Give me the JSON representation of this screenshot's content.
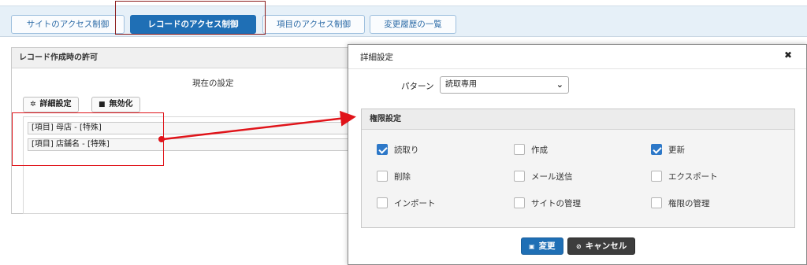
{
  "tabs": [
    {
      "label": "サイトのアクセス制御"
    },
    {
      "label": "レコードのアクセス制御"
    },
    {
      "label": "項目のアクセス制御"
    },
    {
      "label": "変更履歴の一覧"
    }
  ],
  "record_panel": {
    "header": "レコード作成時の許可",
    "current_settings_label": "現在の設定",
    "advanced_button": "詳細設定",
    "disable_button": "無効化",
    "permission_items": [
      "[項目] 母店 - [特殊]",
      "[項目] 店舗名 - [特殊]"
    ]
  },
  "dialog": {
    "title": "詳細設定",
    "close_glyph": "✖",
    "pattern_label": "パターン",
    "pattern_value": "読取専用",
    "permissions_header": "権限設定",
    "permissions": [
      {
        "label": "読取り",
        "checked": true
      },
      {
        "label": "作成",
        "checked": false
      },
      {
        "label": "更新",
        "checked": true
      },
      {
        "label": "削除",
        "checked": false
      },
      {
        "label": "メール送信",
        "checked": false
      },
      {
        "label": "エクスポート",
        "checked": false
      },
      {
        "label": "インポート",
        "checked": false
      },
      {
        "label": "サイトの管理",
        "checked": false
      },
      {
        "label": "権限の管理",
        "checked": false
      }
    ],
    "ok_button": "変更",
    "cancel_button": "キャンセル"
  },
  "colors": {
    "accent": "#1f6fb5",
    "highlight_red": "#e0141a"
  }
}
